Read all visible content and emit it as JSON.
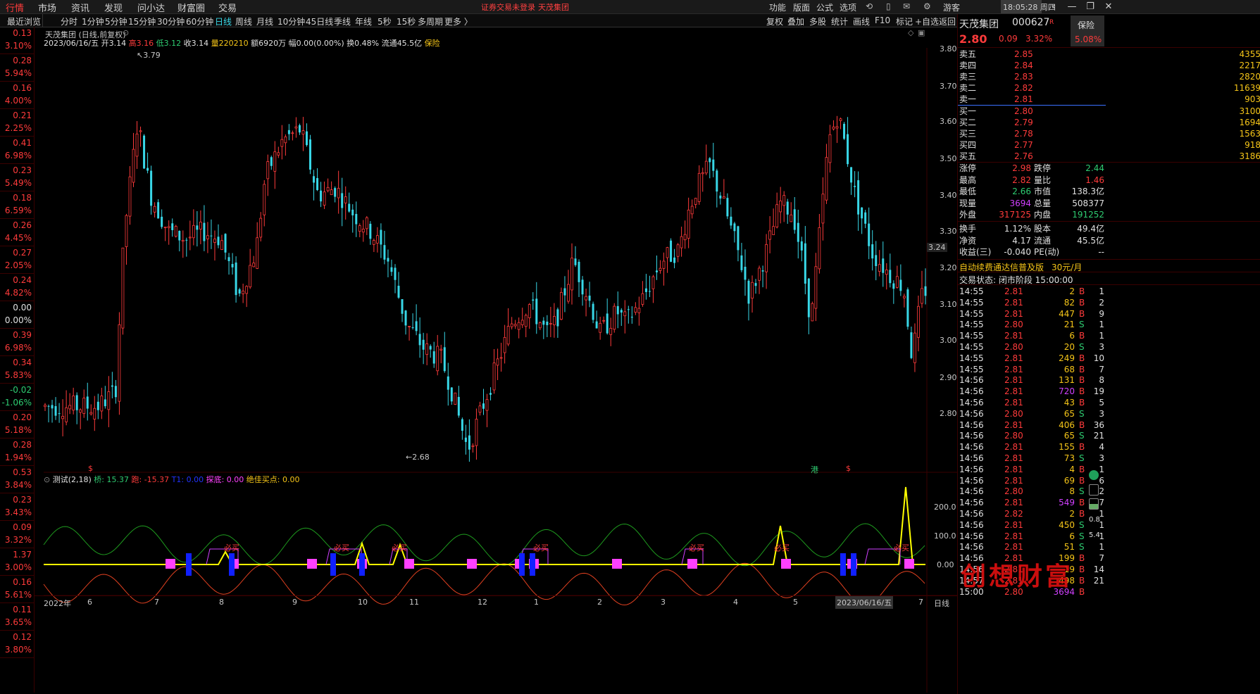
{
  "topmenu": {
    "items": [
      "行情",
      "市场",
      "资讯",
      "发现",
      "问小达",
      "财富圈",
      "交易"
    ],
    "warning": "证券交易未登录",
    "stock_title": "天茂集团",
    "right_items": [
      "功能",
      "版面",
      "公式",
      "选项"
    ],
    "user": "游客",
    "clock": "18:05:28 周四"
  },
  "periodbar": {
    "left_tab": "最近浏览",
    "periods": [
      "分时",
      "1分钟",
      "5分钟",
      "15分钟",
      "30分钟",
      "60分钟",
      "日线",
      "周线",
      "月线",
      "10分钟",
      "45日线",
      "季线",
      "年线",
      "5秒",
      "15秒",
      "多周期",
      "更多 〉"
    ],
    "selected": "日线",
    "tools": [
      "复权",
      "叠加",
      "多股",
      "统计",
      "画线",
      "F10",
      "标记",
      "+自选",
      "返回"
    ]
  },
  "leftcol": [
    {
      "v": "0.13",
      "c": "red"
    },
    {
      "v": "3.10%",
      "c": "red"
    },
    {
      "v": "0.28",
      "c": "red"
    },
    {
      "v": "5.94%",
      "c": "red"
    },
    {
      "v": "0.16",
      "c": "red"
    },
    {
      "v": "4.00%",
      "c": "red"
    },
    {
      "v": "0.21",
      "c": "red"
    },
    {
      "v": "2.25%",
      "c": "red"
    },
    {
      "v": "0.41",
      "c": "red"
    },
    {
      "v": "6.98%",
      "c": "red"
    },
    {
      "v": "0.23",
      "c": "red"
    },
    {
      "v": "5.49%",
      "c": "red"
    },
    {
      "v": "0.18",
      "c": "red"
    },
    {
      "v": "6.59%",
      "c": "red"
    },
    {
      "v": "0.26",
      "c": "red"
    },
    {
      "v": "4.45%",
      "c": "red"
    },
    {
      "v": "0.27",
      "c": "red"
    },
    {
      "v": "2.05%",
      "c": "red"
    },
    {
      "v": "0.24",
      "c": "red"
    },
    {
      "v": "4.82%",
      "c": "red"
    },
    {
      "v": "0.00",
      "c": "wht"
    },
    {
      "v": "0.00%",
      "c": "wht"
    },
    {
      "v": "0.39",
      "c": "red"
    },
    {
      "v": "6.98%",
      "c": "red"
    },
    {
      "v": "0.34",
      "c": "red"
    },
    {
      "v": "5.83%",
      "c": "red"
    },
    {
      "v": "-0.02",
      "c": "grn"
    },
    {
      "v": "-1.06%",
      "c": "grn"
    },
    {
      "v": "0.20",
      "c": "red"
    },
    {
      "v": "5.18%",
      "c": "red"
    },
    {
      "v": "0.28",
      "c": "red"
    },
    {
      "v": "1.94%",
      "c": "red"
    },
    {
      "v": "0.53",
      "c": "red"
    },
    {
      "v": "3.84%",
      "c": "red"
    },
    {
      "v": "0.23",
      "c": "red"
    },
    {
      "v": "3.43%",
      "c": "red"
    },
    {
      "v": "0.09",
      "c": "red"
    },
    {
      "v": "3.32%",
      "c": "red"
    },
    {
      "v": "1.37",
      "c": "red"
    },
    {
      "v": "3.00%",
      "c": "red"
    },
    {
      "v": "0.16",
      "c": "red"
    },
    {
      "v": "5.61%",
      "c": "red"
    },
    {
      "v": "0.11",
      "c": "red"
    },
    {
      "v": "3.65%",
      "c": "red"
    },
    {
      "v": "0.12",
      "c": "red"
    },
    {
      "v": "3.80%",
      "c": "red"
    }
  ],
  "chart": {
    "title": "天茂集团 (日线,前复权)",
    "date": "2023/06/16/五",
    "open_label": "开",
    "open": "3.14",
    "high_label": "高",
    "high": "3.16",
    "low_label": "低",
    "low": "3.12",
    "close_label": "收",
    "close": "3.14",
    "vol_label": "量",
    "vol": "220210",
    "amount": "额6920万",
    "range": "幅0.00(0.00%)",
    "turnover": "换0.48%",
    "float_cap": "流通45.5亿",
    "insurance": "保险",
    "price_ticks": [
      "3.80",
      "3.70",
      "3.60",
      "3.50",
      "3.40",
      "3.30",
      "3.20",
      "3.10",
      "3.00",
      "2.90",
      "2.80"
    ],
    "current_price_tag": "3.24",
    "max_label": "3.79",
    "min_label": "2.68",
    "mark_s": "$",
    "mark_gang": "港",
    "indicator_name": "测试(2,18)",
    "ind_qiao": "桥: 15.37",
    "ind_pao": "跑: -15.37",
    "ind_t1": "T1: 0.00",
    "ind_tandi": "探底: 0.00",
    "ind_best": "绝佳买点: 0.00",
    "ind_ticks": [
      "200.0",
      "100.0",
      "0.00"
    ],
    "buy_label": "必买",
    "x_labels": [
      "2022年",
      "6",
      "7",
      "8",
      "9",
      "10",
      "11",
      "12",
      "1",
      "2",
      "3",
      "4",
      "5",
      "2023/06/16/五",
      "7"
    ],
    "x_cursor": "日线"
  },
  "chart_data": {
    "type": "candlestick",
    "title": "天茂集团 (日线,前复权)",
    "ylim": [
      2.68,
      3.8
    ],
    "max": 3.79,
    "min": 2.68,
    "last": {
      "date": "2023/06/16",
      "open": 3.14,
      "high": 3.16,
      "low": 3.12,
      "close": 3.14,
      "volume": 220210
    }
  },
  "rpanel": {
    "name": "天茂集团",
    "code": "000627",
    "badge": "R",
    "tag": "保险",
    "price": "2.80",
    "chg": "0.09",
    "pct": "3.32%",
    "tag_pct": "5.08%",
    "sell": [
      {
        "l": "卖五",
        "p": "2.85",
        "v": "4355"
      },
      {
        "l": "卖四",
        "p": "2.84",
        "v": "2217"
      },
      {
        "l": "卖三",
        "p": "2.83",
        "v": "2820"
      },
      {
        "l": "卖二",
        "p": "2.82",
        "v": "11639"
      },
      {
        "l": "卖一",
        "p": "2.81",
        "v": "903"
      }
    ],
    "buy": [
      {
        "l": "买一",
        "p": "2.80",
        "v": "3100"
      },
      {
        "l": "买二",
        "p": "2.79",
        "v": "1694"
      },
      {
        "l": "买三",
        "p": "2.78",
        "v": "1563"
      },
      {
        "l": "买四",
        "p": "2.77",
        "v": "918"
      },
      {
        "l": "买五",
        "p": "2.76",
        "v": "3186"
      }
    ],
    "stats1": [
      {
        "a": "涨停",
        "av": "2.98",
        "ac": "red",
        "b": "跌停",
        "bv": "2.44",
        "bc": "grn"
      },
      {
        "a": "最高",
        "av": "2.82",
        "ac": "red",
        "b": "量比",
        "bv": "1.46",
        "bc": "red"
      },
      {
        "a": "最低",
        "av": "2.66",
        "ac": "grn",
        "b": "市值",
        "bv": "138.3亿",
        "bc": "wht"
      },
      {
        "a": "现量",
        "av": "3694",
        "ac": "mag",
        "b": "总量",
        "bv": "508377",
        "bc": "wht"
      },
      {
        "a": "外盘",
        "av": "317125",
        "ac": "red",
        "b": "内盘",
        "bv": "191252",
        "bc": "grn"
      }
    ],
    "stats2": [
      {
        "a": "换手",
        "av": "1.12%",
        "b": "股本",
        "bv": "49.4亿"
      },
      {
        "a": "净资",
        "av": "4.17",
        "b": "流通",
        "bv": "45.5亿"
      },
      {
        "a": "收益(三)",
        "av": "-0.040",
        "b": "PE(动)",
        "bv": "--"
      }
    ],
    "promo": "自动续费通达信普及版",
    "promo_price": "30元/月",
    "trade_status": "交易状态: 闭市阶段 15:00:00",
    "ticks": [
      {
        "t": "14:55",
        "p": "2.81",
        "v": "2",
        "d": "B",
        "n": "1"
      },
      {
        "t": "14:55",
        "p": "2.81",
        "v": "82",
        "d": "B",
        "n": "2"
      },
      {
        "t": "14:55",
        "p": "2.81",
        "v": "447",
        "d": "B",
        "n": "9"
      },
      {
        "t": "14:55",
        "p": "2.80",
        "v": "21",
        "d": "S",
        "n": "1"
      },
      {
        "t": "14:55",
        "p": "2.81",
        "v": "6",
        "d": "B",
        "n": "1"
      },
      {
        "t": "14:55",
        "p": "2.80",
        "v": "20",
        "d": "S",
        "n": "3"
      },
      {
        "t": "14:55",
        "p": "2.81",
        "v": "249",
        "d": "B",
        "n": "10"
      },
      {
        "t": "14:55",
        "p": "2.81",
        "v": "68",
        "d": "B",
        "n": "7"
      },
      {
        "t": "14:56",
        "p": "2.81",
        "v": "131",
        "d": "B",
        "n": "8"
      },
      {
        "t": "14:56",
        "p": "2.81",
        "v": "720",
        "d": "B",
        "n": "19"
      },
      {
        "t": "14:56",
        "p": "2.81",
        "v": "43",
        "d": "B",
        "n": "5"
      },
      {
        "t": "14:56",
        "p": "2.80",
        "v": "65",
        "d": "S",
        "n": "3"
      },
      {
        "t": "14:56",
        "p": "2.81",
        "v": "406",
        "d": "B",
        "n": "36"
      },
      {
        "t": "14:56",
        "p": "2.80",
        "v": "65",
        "d": "S",
        "n": "21"
      },
      {
        "t": "14:56",
        "p": "2.81",
        "v": "155",
        "d": "B",
        "n": "4"
      },
      {
        "t": "14:56",
        "p": "2.81",
        "v": "73",
        "d": "S",
        "n": "3"
      },
      {
        "t": "14:56",
        "p": "2.81",
        "v": "4",
        "d": "B",
        "n": "1"
      },
      {
        "t": "14:56",
        "p": "2.81",
        "v": "69",
        "d": "B",
        "n": "6"
      },
      {
        "t": "14:56",
        "p": "2.80",
        "v": "8",
        "d": "S",
        "n": "2"
      },
      {
        "t": "14:56",
        "p": "2.81",
        "v": "549",
        "d": "B",
        "n": "7"
      },
      {
        "t": "14:56",
        "p": "2.82",
        "v": "2",
        "d": "B",
        "n": "1"
      },
      {
        "t": "14:56",
        "p": "2.81",
        "v": "450",
        "d": "S",
        "n": "1"
      },
      {
        "t": "14:56",
        "p": "2.81",
        "v": "6",
        "d": "S",
        "n": "1"
      },
      {
        "t": "14:56",
        "p": "2.81",
        "v": "51",
        "d": "S",
        "n": "1"
      },
      {
        "t": "14:56",
        "p": "2.81",
        "v": "199",
        "d": "B",
        "n": "7"
      },
      {
        "t": "14:56",
        "p": "2.81",
        "v": "19",
        "d": "B",
        "n": "14"
      },
      {
        "t": "14:57",
        "p": "2.81",
        "v": "498",
        "d": "B",
        "n": "21"
      },
      {
        "t": "15:00",
        "p": "2.80",
        "v": "3694",
        "d": "B",
        "n": ""
      }
    ],
    "side_vals": [
      "0.8",
      "5.4"
    ],
    "watermark": "创想财富"
  },
  "colors": {
    "up": "#ff3b3b",
    "down": "#38d7e7",
    "bg": "#000000"
  }
}
